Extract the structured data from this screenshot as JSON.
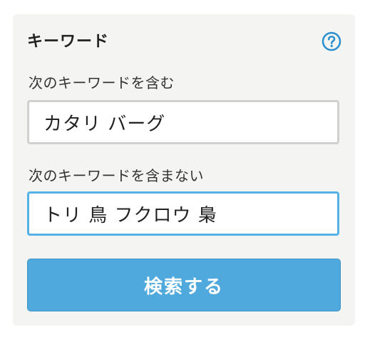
{
  "panel": {
    "title": "キーワード",
    "help_icon": "question-circle-icon",
    "accent_color": "#2a8fcf"
  },
  "include": {
    "label": "次のキーワードを含む",
    "value": "カタリ バーグ"
  },
  "exclude": {
    "label": "次のキーワードを含まない",
    "value": "トリ 鳥 フクロウ 梟"
  },
  "search_button": {
    "label": "検索する",
    "color": "#4fa9dd"
  }
}
